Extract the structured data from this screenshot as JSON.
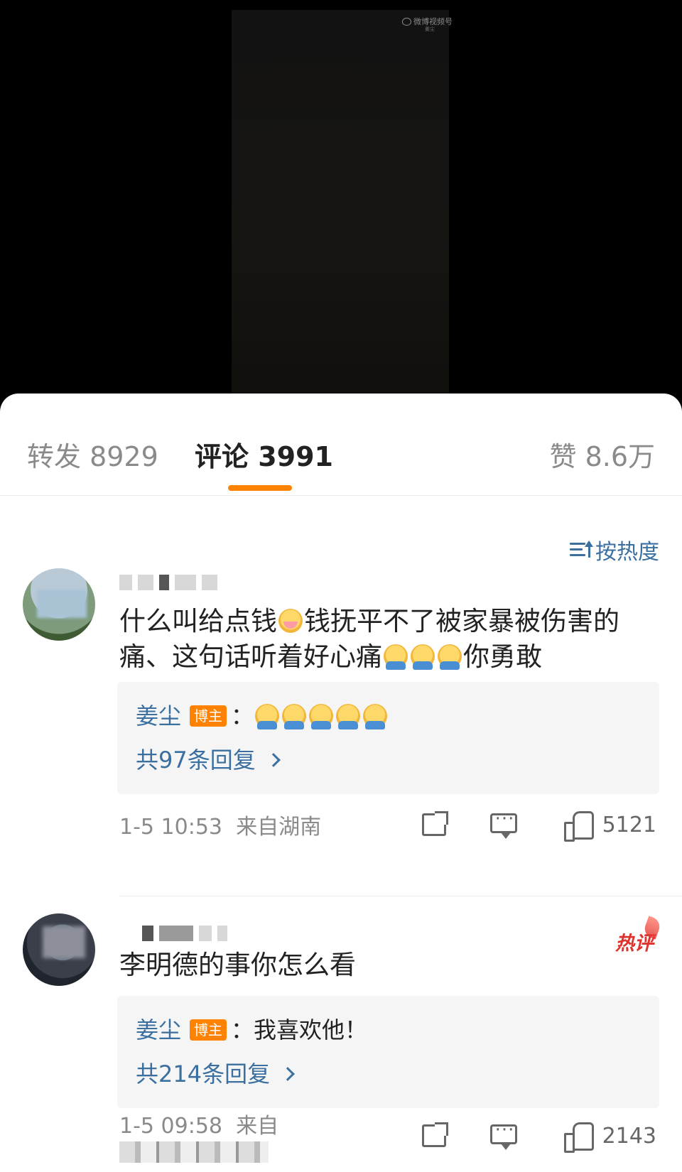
{
  "video": {
    "watermark": "微博视频号",
    "watermark_sub": "姜尘"
  },
  "tabs": {
    "repost": "转发 8929",
    "comments": "评论 3991",
    "likes": "赞 8.6万"
  },
  "sort": {
    "label": "按热度"
  },
  "comments": [
    {
      "text_a": "什么叫给点钱",
      "text_b": "钱抚平不了被家暴被伤害的痛、这句话听着好心痛",
      "text_c": "你勇敢",
      "reply": {
        "name": "姜尘",
        "badge": "博主",
        "sep": "："
      },
      "more": "共97条回复",
      "time": "1-5 10:53",
      "location": "来自湖南",
      "likes": "5121"
    },
    {
      "badge": "热评",
      "text": "李明德的事你怎么看",
      "reply": {
        "name": "姜尘",
        "badge": "博主",
        "text": "：我喜欢他！"
      },
      "more": "共214条回复",
      "time": "1-5 09:58",
      "location_prefix": "来自",
      "likes": "2143"
    }
  ]
}
